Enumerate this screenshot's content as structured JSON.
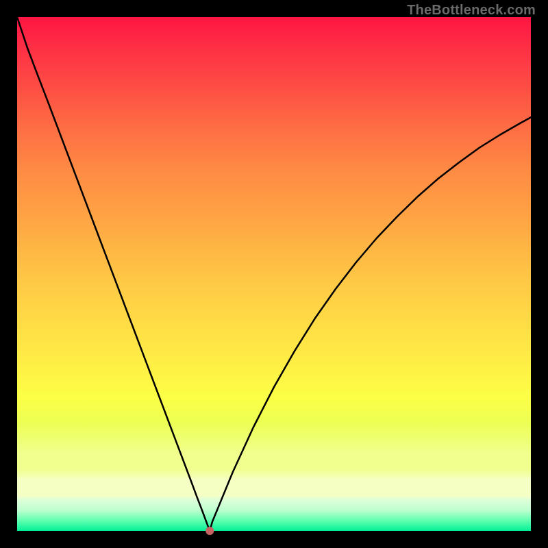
{
  "watermark": "TheBottleneck.com",
  "colors": {
    "gradient_top": "#fe1643",
    "gradient_bottom": "#02f097",
    "curve_stroke": "#000000",
    "marker_fill": "#c86464",
    "frame": "#000000"
  },
  "chart_data": {
    "type": "line",
    "title": "",
    "xlabel": "",
    "ylabel": "",
    "xlim": [
      0,
      100
    ],
    "ylim": [
      0,
      100
    ],
    "grid": false,
    "legend": false,
    "annotations": [],
    "x": [
      0,
      2,
      4,
      6,
      8,
      10,
      12,
      14,
      16,
      18,
      20,
      22,
      24,
      26,
      28,
      30,
      32,
      34,
      35,
      36,
      37,
      37.5,
      38,
      42,
      46,
      50,
      54,
      58,
      62,
      66,
      70,
      74,
      78,
      82,
      86,
      90,
      94,
      98,
      100
    ],
    "y": [
      100,
      94,
      88.7,
      83.5,
      78.2,
      72.9,
      67.6,
      62.3,
      57.0,
      51.7,
      46.4,
      41.1,
      35.8,
      30.5,
      25.2,
      19.9,
      14.6,
      9.3,
      6.6,
      4.0,
      1.3,
      0.0,
      1.8,
      11.5,
      20.2,
      28.0,
      35.0,
      41.4,
      47.1,
      52.3,
      57.0,
      61.2,
      65.1,
      68.6,
      71.7,
      74.6,
      77.1,
      79.4,
      80.5
    ],
    "marker": {
      "x": 37.5,
      "y": 0
    },
    "description": "V-shaped bottleneck curve with minimum near x=37.5. Left branch is approximately linear descending from (0,100) to the minimum; right branch rises with diminishing slope toward (100,80.5). Background is a vertical gradient from red (high bottleneck) through orange/yellow to green (low bottleneck)."
  }
}
